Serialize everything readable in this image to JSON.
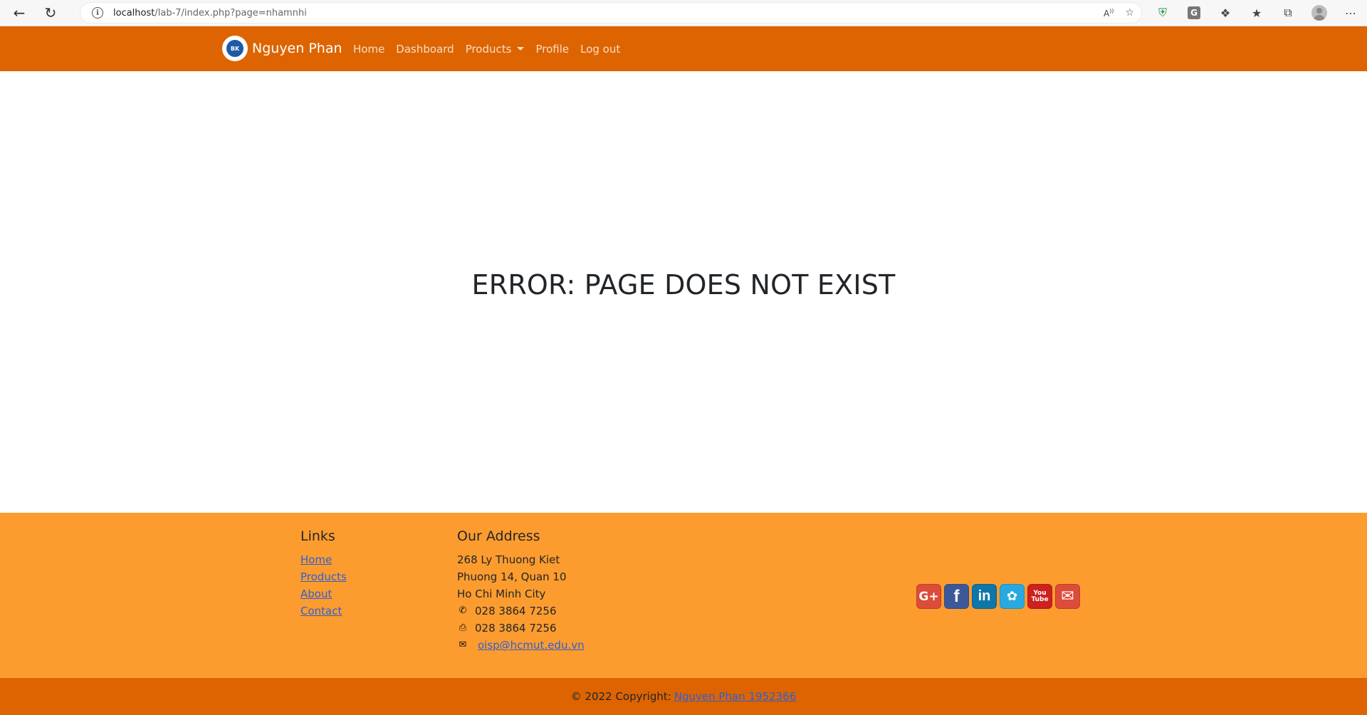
{
  "browser": {
    "url_host": "localhost",
    "url_path": "/lab-7/index.php?page=nhamnhi"
  },
  "navbar": {
    "brand_name": "Nguyen Phan",
    "logo_text": "BK",
    "links": {
      "home": "Home",
      "dashboard": "Dashboard",
      "products": "Products",
      "profile": "Profile",
      "logout": "Log out"
    }
  },
  "main": {
    "error_message": "ERROR: PAGE DOES NOT EXIST"
  },
  "footer": {
    "links_heading": "Links",
    "links": {
      "home": "Home",
      "products": "Products",
      "about": "About",
      "contact": "Contact"
    },
    "address_heading": "Our Address",
    "address_line1": "268 Ly Thuong Kiet",
    "address_line2": "Phuong 14, Quan 10",
    "address_line3": "Ho Chi Minh City",
    "phone": "028 3864 7256",
    "fax": "028 3864 7256",
    "email": "oisp@hcmut.edu.vn",
    "social_icons": [
      "google-plus-icon",
      "facebook-icon",
      "linkedin-icon",
      "twitter-icon",
      "youtube-icon",
      "mail-icon"
    ]
  },
  "copyright": {
    "text": "© 2022 Copyright:",
    "link_text": "Nguyen Phan 1952366"
  },
  "colors": {
    "navbar": "#dd6400",
    "footer": "#fd9c2e",
    "link": "#2f5fd0"
  }
}
